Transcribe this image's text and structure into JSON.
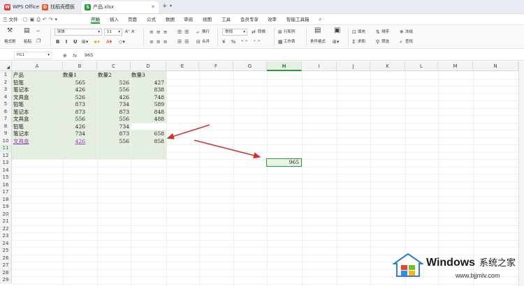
{
  "tabs": [
    {
      "label": "WPS Office"
    },
    {
      "label": "找稻壳模板"
    },
    {
      "label": "产品.xlsx"
    }
  ],
  "menu": [
    "三 文件",
    "开始",
    "插入",
    "页面",
    "公式",
    "数据",
    "审阅",
    "视图",
    "工具",
    "会员专享",
    "效率",
    "智能工具箱"
  ],
  "active_menu": "开始",
  "ribbon": {
    "format_painter": "格式刷",
    "paste": "粘贴",
    "font_name": "宋体",
    "font_size": "11",
    "wrap": "换行",
    "merge": "合并",
    "number_format": "常规",
    "convert": "转换",
    "row_col": "行和列",
    "worksheet": "工作表",
    "cond_format": "条件格式",
    "fill": "填充",
    "sort": "排序",
    "freeze": "冻结",
    "sum": "求和",
    "filter": "筛选",
    "find": "查找"
  },
  "formula_bar": {
    "name_box": "H11",
    "fx": "fx",
    "value": "965"
  },
  "columns": [
    "A",
    "B",
    "C",
    "D",
    "E",
    "F",
    "G",
    "H",
    "I",
    "J",
    "K",
    "L",
    "M",
    "N"
  ],
  "selected_column": "H",
  "rows": [
    "1",
    "2",
    "3",
    "4",
    "5",
    "6",
    "7",
    "8",
    "9",
    "10",
    "11",
    "12",
    "13",
    "14",
    "15",
    "16",
    "17",
    "18",
    "19",
    "20",
    "21",
    "22",
    "23",
    "24",
    "25",
    "26",
    "27",
    "28",
    "29"
  ],
  "selected_row": "11",
  "table": {
    "headers": [
      "产品",
      "数量1",
      "数量2",
      "数量3"
    ],
    "data": [
      [
        "铅笔",
        "565",
        "526",
        "427"
      ],
      [
        "笔记本",
        "426",
        "556",
        "838"
      ],
      [
        "文具盒",
        "526",
        "426",
        "748"
      ],
      [
        "铅笔",
        "873",
        "734",
        "589"
      ],
      [
        "笔记本",
        "873",
        "873",
        "848"
      ],
      [
        "文具盒",
        "556",
        "556",
        "488"
      ],
      [
        "铅笔",
        "426",
        "734",
        ""
      ],
      [
        "笔记本",
        "734",
        "873",
        "658"
      ],
      [
        "文具盒",
        "426",
        "556",
        "858"
      ]
    ]
  },
  "selected_cell_value": "965",
  "watermark": {
    "brand": "Windows",
    "cn": "系统之家",
    "url": "www.bjjmlv.com"
  },
  "colors": {
    "accent": "#2a9a3e",
    "range_fill": "#e3eede",
    "arrow": "#d0312d"
  }
}
